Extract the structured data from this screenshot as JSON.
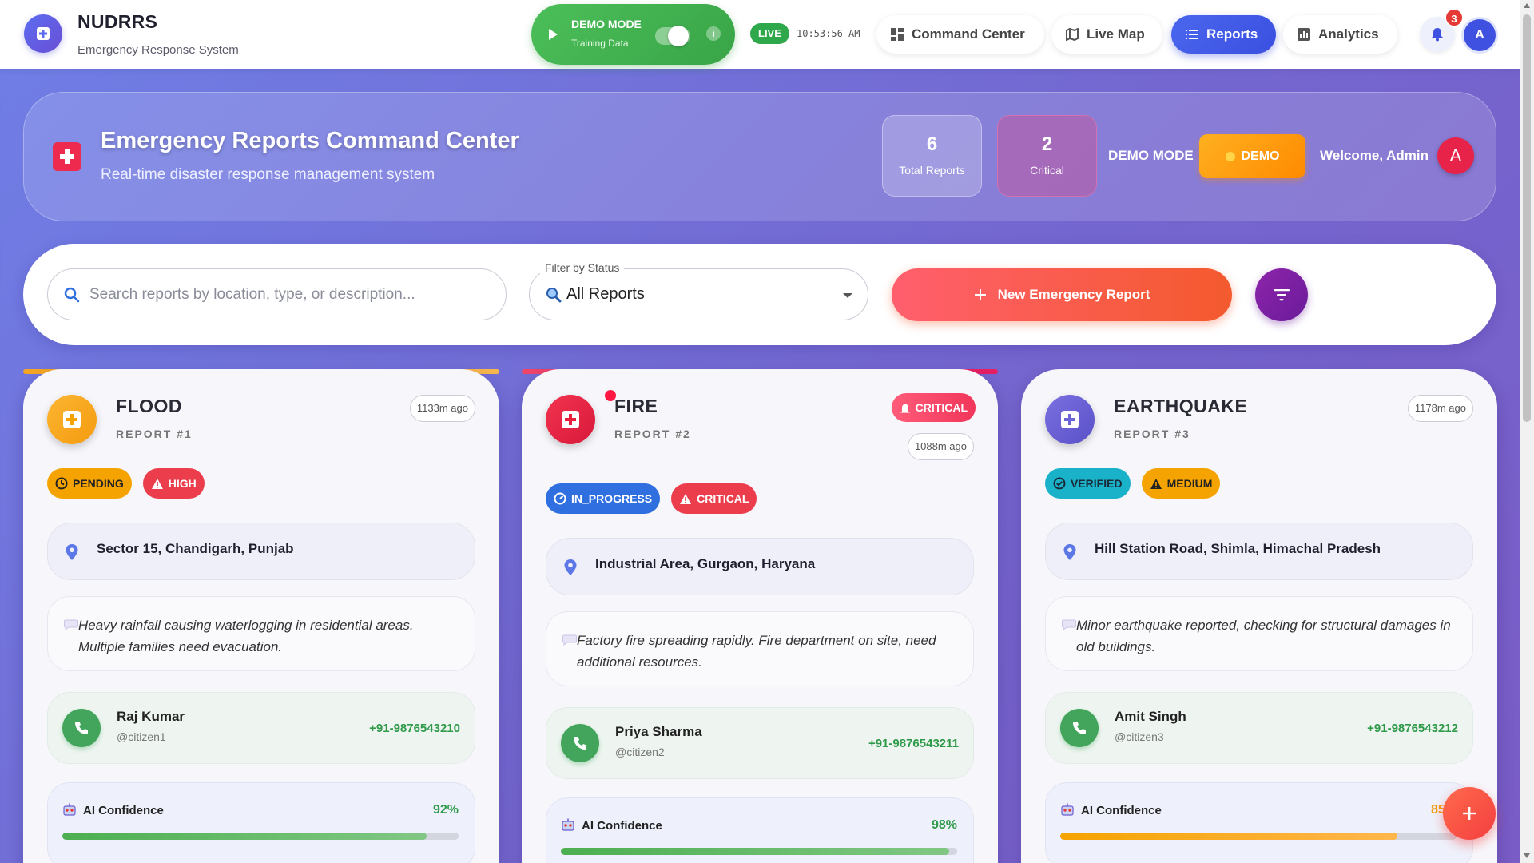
{
  "app": {
    "title": "NUDRRS",
    "subtitle": "Emergency Response System"
  },
  "demo_toggle": {
    "title": "DEMO MODE",
    "subtitle": "Training Data",
    "enabled": true
  },
  "live": {
    "label": "LIVE",
    "time": "10:53:56 AM"
  },
  "nav": {
    "items": [
      {
        "label": "Command Center",
        "icon": "dashboard-icon",
        "active": false
      },
      {
        "label": "Live Map",
        "icon": "map-icon",
        "active": false
      },
      {
        "label": "Reports",
        "icon": "list-icon",
        "active": true
      },
      {
        "label": "Analytics",
        "icon": "analytics-icon",
        "active": false
      }
    ],
    "notification_count": "3",
    "avatar_initial": "A"
  },
  "header": {
    "title": "Emergency Reports Command Center",
    "subtitle": "Real-time disaster response management system",
    "stats": [
      {
        "value": "6",
        "label": "Total Reports"
      },
      {
        "value": "2",
        "label": "Critical"
      }
    ],
    "demo_label": "DEMO MODE",
    "demo_button": "DEMO",
    "welcome": "Welcome, Admin",
    "avatar_initial": "A"
  },
  "filters": {
    "search_placeholder": "Search reports by location, type, or description...",
    "status_label": "Filter by Status",
    "status_value": "All Reports",
    "new_report_label": "New Emergency Report"
  },
  "colors": {
    "flood": "#f9a825",
    "fire": "#e91e3c",
    "earthquake": "#6c63d6",
    "accent": "#3a4fe0"
  },
  "reports": [
    {
      "type": "FLOOD",
      "number": "REPORT #1",
      "time_ago": "1133m ago",
      "status": "PENDING",
      "severity": "HIGH",
      "location": "Sector 15, Chandigarh, Punjab",
      "description": "Heavy rainfall causing waterlogging in residential areas. Multiple families need evacuation.",
      "reporter_name": "Raj Kumar",
      "reporter_user": "@citizen1",
      "phone": "+91-9876543210",
      "ai_label": "AI Confidence",
      "ai_confidence": "92%",
      "ai_fraction": 0.92
    },
    {
      "type": "FIRE",
      "number": "REPORT #2",
      "time_ago": "1088m ago",
      "priority_badge": "CRITICAL",
      "status": "IN_PROGRESS",
      "severity": "CRITICAL",
      "location": "Industrial Area, Gurgaon, Haryana",
      "description": "Factory fire spreading rapidly. Fire department on site, need additional resources.",
      "reporter_name": "Priya Sharma",
      "reporter_user": "@citizen2",
      "phone": "+91-9876543211",
      "ai_label": "AI Confidence",
      "ai_confidence": "98%",
      "ai_fraction": 0.98
    },
    {
      "type": "EARTHQUAKE",
      "number": "REPORT #3",
      "time_ago": "1178m ago",
      "status": "VERIFIED",
      "severity": "MEDIUM",
      "location": "Hill Station Road, Shimla, Himachal Pradesh",
      "description": "Minor earthquake reported, checking for structural damages in old buildings.",
      "reporter_name": "Amit Singh",
      "reporter_user": "@citizen3",
      "phone": "+91-9876543212",
      "ai_label": "AI Confidence",
      "ai_confidence": "85%",
      "ai_fraction": 0.85
    }
  ]
}
